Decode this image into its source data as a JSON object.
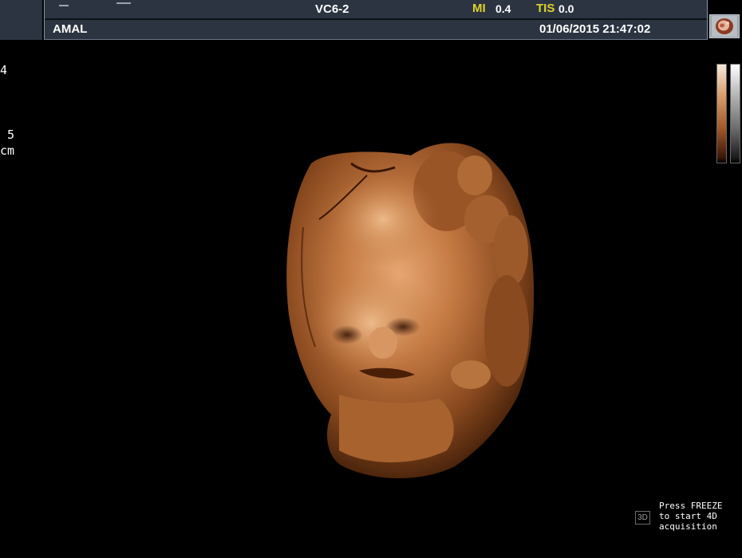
{
  "header": {
    "probe": "VC6-2",
    "mi_label": "MI",
    "mi_value": "0.4",
    "tis_label": "TIS",
    "tis_value": "0.0",
    "patient_name": "AMAL",
    "datetime": "01/06/2015 21:47:02"
  },
  "depth_scale": {
    "tick_top": "4",
    "tick_mid": "5",
    "unit": "cm"
  },
  "status": {
    "mode_badge": "3D",
    "instruction_lines": [
      "Press FREEZE",
      "to start 4D",
      "acquisition"
    ]
  },
  "icons": {
    "thumbnail": "fetus-thumbnail-icon"
  },
  "colors": {
    "header_bg": "#2b3440",
    "accent_yellow": "#e0d12a",
    "render_sepia": "#b8703a"
  }
}
